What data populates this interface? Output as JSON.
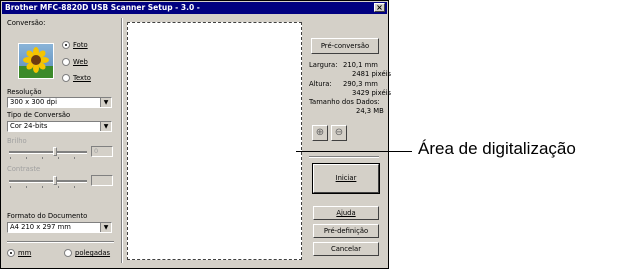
{
  "window": {
    "title": "Brother MFC-8820D USB Scanner Setup - 3.0 -",
    "close_glyph": "×"
  },
  "scan_type": {
    "label": "Conversão:",
    "options": [
      {
        "label": "Foto",
        "selected": true
      },
      {
        "label": "Web",
        "selected": false
      },
      {
        "label": "Texto",
        "selected": false
      }
    ],
    "preview_icon": "sunflower-photo-icon"
  },
  "resolution": {
    "label": "Resolução",
    "value": "300 x 300 dpi"
  },
  "scan_mode": {
    "label": "Tipo de Conversão",
    "value": "Cor 24-bits"
  },
  "brightness": {
    "label": "Brilho",
    "value": "0"
  },
  "contrast": {
    "label": "Contraste",
    "value": ""
  },
  "document_size": {
    "label": "Formato do Documento",
    "value": "A4 210 x 297 mm"
  },
  "units": [
    {
      "label": "mm",
      "selected": true
    },
    {
      "label": "polegadas",
      "selected": false
    }
  ],
  "info": {
    "width_label": "Largura:",
    "width_mm": "210,1 mm",
    "width_px": "2481 pixéis",
    "height_label": "Altura:",
    "height_mm": "290,3 mm",
    "height_px": "3429 pixéis",
    "size_label": "Tamanho dos Dados:",
    "size_value": "24,3 MB"
  },
  "buttons": {
    "prescan": "Pré-conversão",
    "start": "Iniciar",
    "help": "Ajuda",
    "default": "Pré-definição",
    "cancel": "Cancelar"
  },
  "callout": "Área de digitalização"
}
